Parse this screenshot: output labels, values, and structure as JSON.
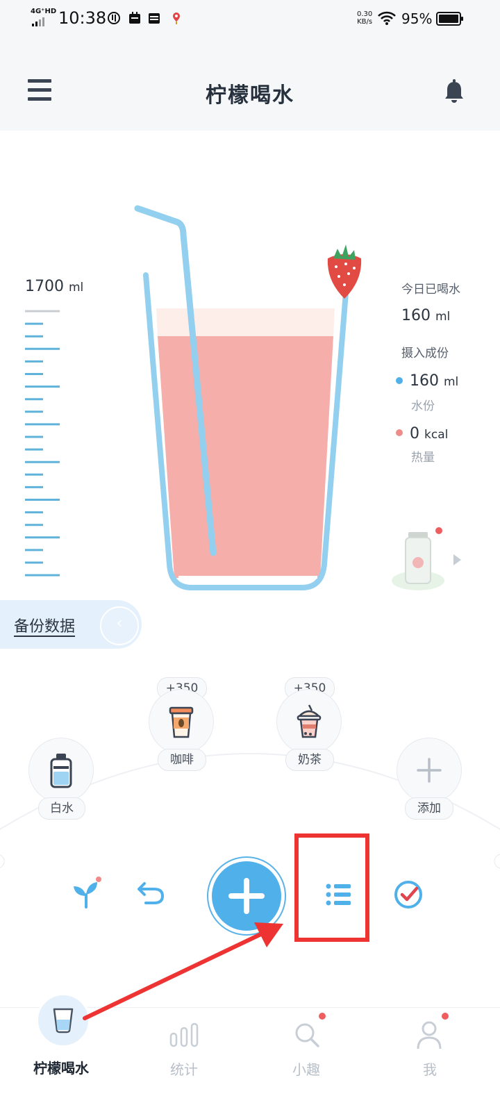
{
  "status_bar": {
    "network": "4G⁺HD",
    "time": "10:38",
    "speed_value": "0.30",
    "speed_unit": "KB/s",
    "battery": "95%"
  },
  "header": {
    "title": "柠檬喝水",
    "menu_icon": "hamburger-menu-icon",
    "bell_icon": "bell-icon"
  },
  "goal": {
    "value": "1700",
    "unit": "ml"
  },
  "today": {
    "label": "今日已喝水",
    "value": "160",
    "unit": "ml",
    "intake_label": "摄入成份",
    "water": {
      "value": "160",
      "unit": "ml",
      "label": "水份",
      "color": "#4fb0ea"
    },
    "calories": {
      "value": "0",
      "unit": "kcal",
      "label": "热量",
      "color": "#ee8c8c"
    }
  },
  "backup": {
    "label": "备份数据"
  },
  "drinks": [
    {
      "name": "白水",
      "icon": "water-bottle-icon"
    },
    {
      "name": "咖啡",
      "amount": "+350",
      "icon": "coffee-cup-icon"
    },
    {
      "name": "奶茶",
      "amount": "+350",
      "icon": "milk-tea-icon"
    },
    {
      "name": "添加",
      "icon": "plus-icon"
    }
  ],
  "actions": {
    "plant": "sprout-icon",
    "undo": "undo-icon",
    "add": "plus-icon",
    "list": "list-icon",
    "check": "check-circle-icon"
  },
  "tabs": [
    {
      "label": "柠檬喝水",
      "icon": "cup-icon",
      "active": true
    },
    {
      "label": "统计",
      "icon": "bar-chart-icon",
      "active": false
    },
    {
      "label": "小趣",
      "icon": "search-icon",
      "active": false
    },
    {
      "label": "我",
      "icon": "profile-icon",
      "active": false
    }
  ],
  "colors": {
    "accent": "#4fb0ea",
    "juice": "#f6aeaa",
    "highlight": "#ee3333"
  }
}
